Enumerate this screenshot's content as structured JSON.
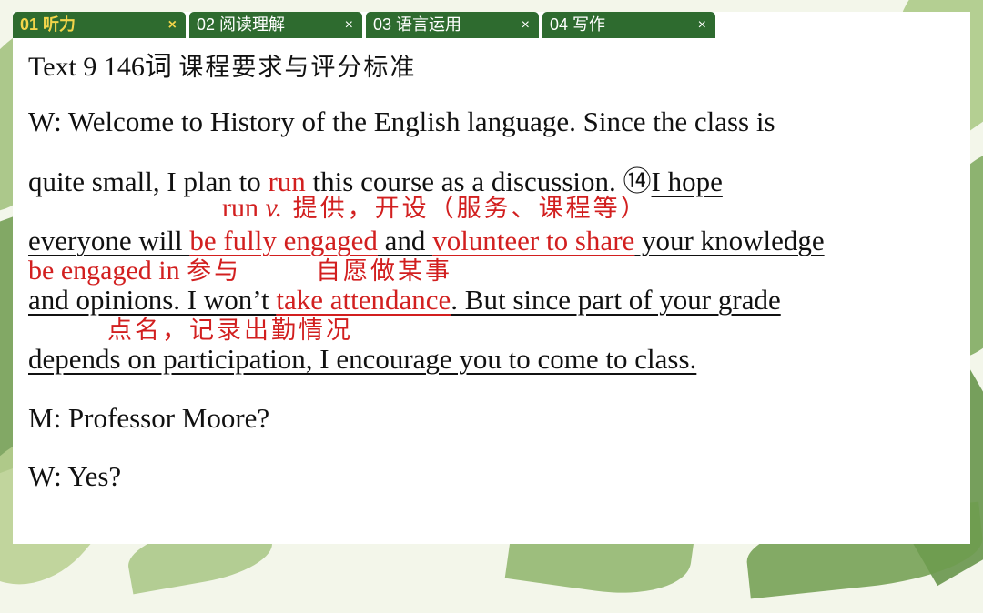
{
  "tabs": [
    {
      "label": "01 听力",
      "close": "×"
    },
    {
      "label": "02 阅读理解",
      "close": "×"
    },
    {
      "label": "03 语言运用",
      "close": "×"
    },
    {
      "label": "04 写作",
      "close": "×"
    }
  ],
  "title": {
    "en": "Text 9  146词 ",
    "zh": "课程要求与评分标准"
  },
  "lines": {
    "l1": "W: Welcome to History of the English language. Since the class is",
    "l2": {
      "a": "quite small, I plan to ",
      "b": "run",
      "c": " this course as a discussion. ",
      "d": "⑭",
      "e": "I hope"
    },
    "l3": {
      "a": "everyone will ",
      "b": "be fully engaged",
      "c": " and ",
      "d": "volunteer to share",
      "e": " your knowledge"
    },
    "l4": {
      "a": "and opinions. I won’t ",
      "b": "take attendance",
      "c": ". But since part of your grade"
    },
    "l5": "depends on participation, I encourage you to come to class.",
    "l6": "M: Professor Moore?",
    "l7": "W: Yes?"
  },
  "notes": {
    "n1": {
      "en": "run ",
      "it": "v.",
      "zh": " 提供，开设（服务、课程等）"
    },
    "n2": {
      "en": "be engaged in ",
      "zh": "参与"
    },
    "n2b": {
      "zh": "自愿做某事"
    },
    "n3": {
      "zh": "点名，记录出勤情况"
    }
  }
}
